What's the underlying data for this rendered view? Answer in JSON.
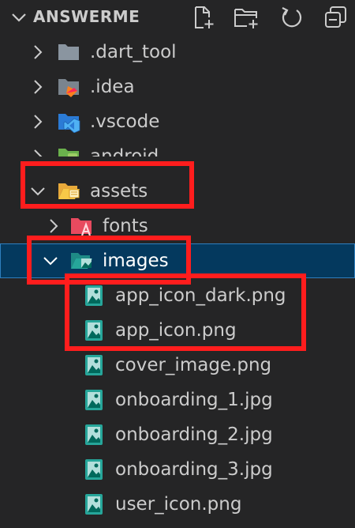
{
  "explorer": {
    "title": "ANSWERME",
    "actions": [
      {
        "name": "new-file-icon"
      },
      {
        "name": "new-folder-icon"
      },
      {
        "name": "refresh-icon"
      },
      {
        "name": "collapse-all-icon"
      }
    ]
  },
  "tree": [
    {
      "label": ".dart_tool",
      "kind": "folder",
      "expanded": false,
      "depth": 0,
      "icon": "folder-icon"
    },
    {
      "label": ".idea",
      "kind": "folder",
      "expanded": false,
      "depth": 0,
      "icon": "idea-folder-icon"
    },
    {
      "label": ".vscode",
      "kind": "folder",
      "expanded": false,
      "depth": 0,
      "icon": "vscode-folder-icon"
    },
    {
      "label": "android",
      "kind": "folder",
      "expanded": false,
      "depth": 0,
      "icon": "android-folder-icon"
    },
    {
      "label": "assets",
      "kind": "folder",
      "expanded": true,
      "depth": 0,
      "icon": "open-folder-icon"
    },
    {
      "label": "fonts",
      "kind": "folder",
      "expanded": false,
      "depth": 1,
      "icon": "fonts-folder-icon"
    },
    {
      "label": "images",
      "kind": "folder",
      "expanded": true,
      "depth": 1,
      "icon": "images-folder-icon",
      "selected": true
    },
    {
      "label": "app_icon_dark.png",
      "kind": "file",
      "depth": 2,
      "icon": "image-file-icon"
    },
    {
      "label": "app_icon.png",
      "kind": "file",
      "depth": 2,
      "icon": "image-file-icon"
    },
    {
      "label": "cover_image.png",
      "kind": "file",
      "depth": 2,
      "icon": "image-file-icon"
    },
    {
      "label": "onboarding_1.jpg",
      "kind": "file",
      "depth": 2,
      "icon": "image-file-icon"
    },
    {
      "label": "onboarding_2.jpg",
      "kind": "file",
      "depth": 2,
      "icon": "image-file-icon"
    },
    {
      "label": "onboarding_3.jpg",
      "kind": "file",
      "depth": 2,
      "icon": "image-file-icon"
    },
    {
      "label": "user_icon.png",
      "kind": "file",
      "depth": 2,
      "icon": "image-file-icon"
    }
  ],
  "colors": {
    "background": "#252526",
    "selection": "#04395e",
    "highlight_box": "#ff1d1d",
    "text": "#cccccc"
  }
}
